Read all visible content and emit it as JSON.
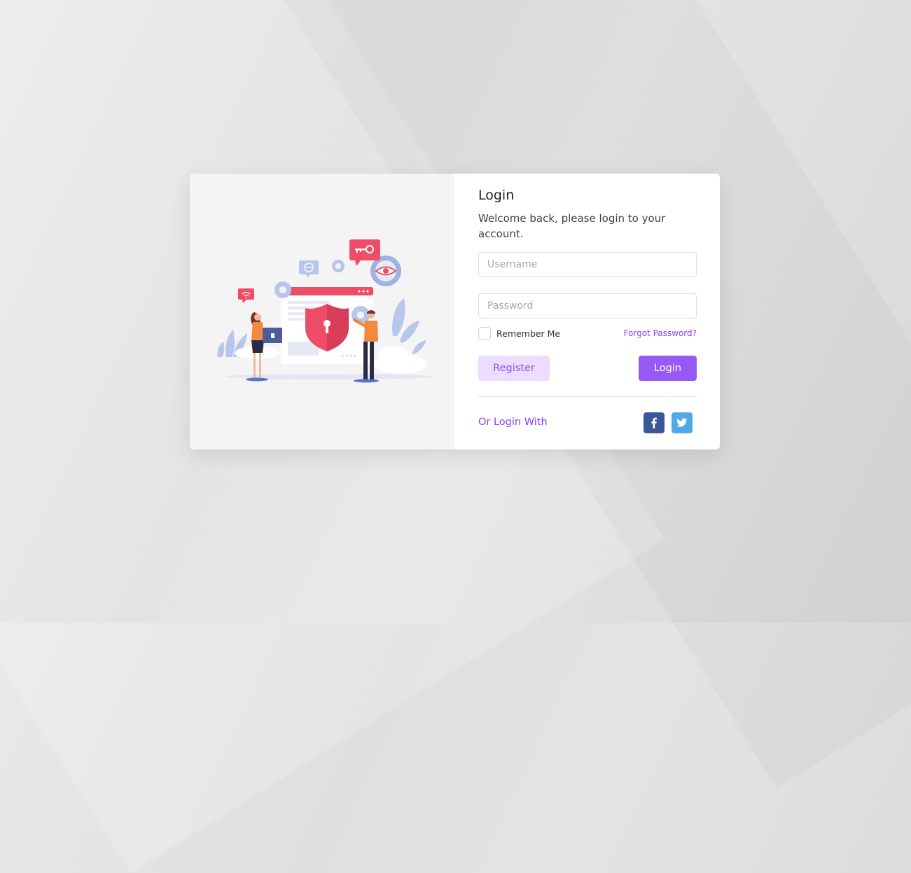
{
  "login": {
    "title": "Login",
    "subtitle": "Welcome back, please login to your account.",
    "username_placeholder": "Username",
    "password_placeholder": "Password",
    "remember_label": "Remember Me",
    "remember_checked": false,
    "forgot_label": "Forgot Password?",
    "register_label": "Register",
    "login_label": "Login",
    "or_login_with": "Or Login With"
  },
  "social": {
    "facebook_icon": "facebook-icon",
    "twitter_icon": "twitter-icon"
  },
  "colors": {
    "accent": "#9659f5",
    "accent_light": "#ecdcfd",
    "facebook": "#3b5798",
    "twitter": "#4fa9e8",
    "illustration_red": "#ee4d67"
  }
}
